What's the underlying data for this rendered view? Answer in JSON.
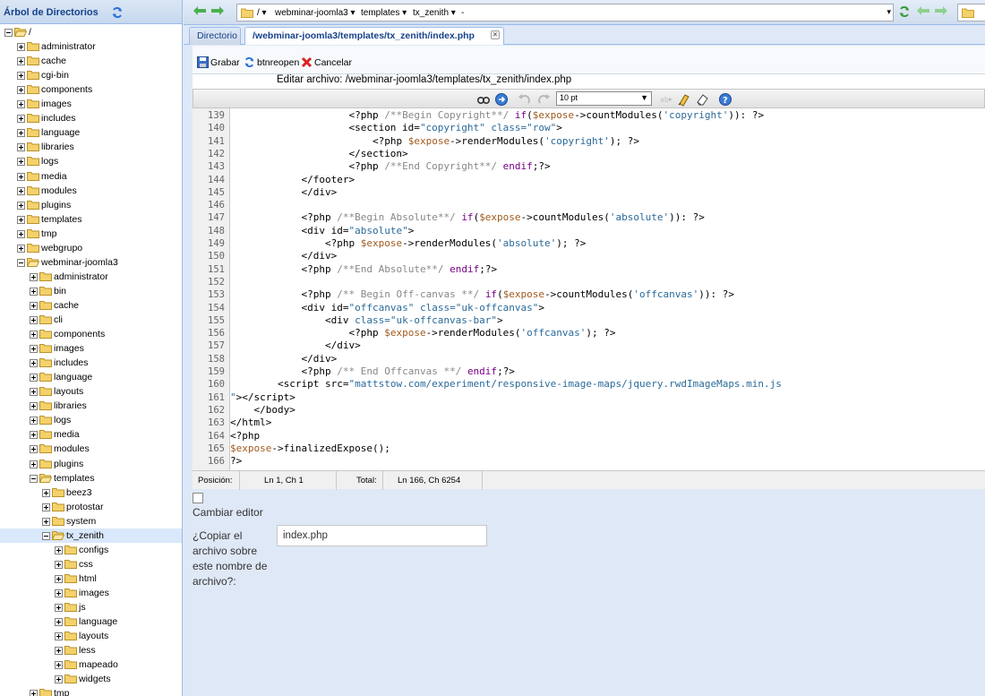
{
  "sidebar": {
    "title": "Árbol de Directorios",
    "tree": [
      {
        "label": "/",
        "depth": 0,
        "open": true
      },
      {
        "label": "administrator",
        "depth": 1
      },
      {
        "label": "cache",
        "depth": 1
      },
      {
        "label": "cgi-bin",
        "depth": 1
      },
      {
        "label": "components",
        "depth": 1
      },
      {
        "label": "images",
        "depth": 1
      },
      {
        "label": "includes",
        "depth": 1
      },
      {
        "label": "language",
        "depth": 1
      },
      {
        "label": "libraries",
        "depth": 1
      },
      {
        "label": "logs",
        "depth": 1
      },
      {
        "label": "media",
        "depth": 1
      },
      {
        "label": "modules",
        "depth": 1
      },
      {
        "label": "plugins",
        "depth": 1
      },
      {
        "label": "templates",
        "depth": 1
      },
      {
        "label": "tmp",
        "depth": 1
      },
      {
        "label": "webgrupo",
        "depth": 1
      },
      {
        "label": "webminar-joomla3",
        "depth": 1,
        "open": true
      },
      {
        "label": "administrator",
        "depth": 2
      },
      {
        "label": "bin",
        "depth": 2
      },
      {
        "label": "cache",
        "depth": 2
      },
      {
        "label": "cli",
        "depth": 2
      },
      {
        "label": "components",
        "depth": 2
      },
      {
        "label": "images",
        "depth": 2
      },
      {
        "label": "includes",
        "depth": 2
      },
      {
        "label": "language",
        "depth": 2
      },
      {
        "label": "layouts",
        "depth": 2
      },
      {
        "label": "libraries",
        "depth": 2
      },
      {
        "label": "logs",
        "depth": 2
      },
      {
        "label": "media",
        "depth": 2
      },
      {
        "label": "modules",
        "depth": 2
      },
      {
        "label": "plugins",
        "depth": 2
      },
      {
        "label": "templates",
        "depth": 2,
        "open": true
      },
      {
        "label": "beez3",
        "depth": 3
      },
      {
        "label": "protostar",
        "depth": 3
      },
      {
        "label": "system",
        "depth": 3
      },
      {
        "label": "tx_zenith",
        "depth": 3,
        "open": true,
        "selected": true
      },
      {
        "label": "configs",
        "depth": 4
      },
      {
        "label": "css",
        "depth": 4
      },
      {
        "label": "html",
        "depth": 4
      },
      {
        "label": "images",
        "depth": 4
      },
      {
        "label": "js",
        "depth": 4
      },
      {
        "label": "language",
        "depth": 4
      },
      {
        "label": "layouts",
        "depth": 4
      },
      {
        "label": "less",
        "depth": 4
      },
      {
        "label": "mapeado",
        "depth": 4
      },
      {
        "label": "widgets",
        "depth": 4
      },
      {
        "label": "tmp",
        "depth": 2
      }
    ]
  },
  "pathbar": {
    "crumbs": [
      "/",
      "webminar-joomla3",
      "templates",
      "tx_zenith",
      "-"
    ]
  },
  "tabs": {
    "directory": "Directorio",
    "file": "/webminar-joomla3/templates/tx_zenith/index.php"
  },
  "actions": {
    "save": "Grabar",
    "reopen": "btnreopen",
    "cancel": "Cancelar"
  },
  "edit_label": "Editar archivo: /webminar-joomla3/templates/tx_zenith/index.php",
  "editor": {
    "font_size": "10 pt",
    "lines": [
      {
        "n": "139",
        "html": "                    <span class=\"t\">&lt;?php</span> <span class=\"c\">/**Begin Copyright**/</span> <span class=\"k\">if</span>(<span class=\"v\">$expose</span>-&gt;countModules(<span class=\"q\">'copyright'</span>)): <span class=\"t\">?&gt;</span>"
      },
      {
        "n": "140",
        "html": "                    <span class=\"t\">&lt;section</span> id=<span class=\"q\">\"copyright\"</span> <span class=\"q\">class=\"row\"</span><span class=\"t\">&gt;</span>"
      },
      {
        "n": "141",
        "html": "                        <span class=\"t\">&lt;?php</span> <span class=\"v\">$expose</span>-&gt;renderModules(<span class=\"q\">'copyright'</span>); <span class=\"t\">?&gt;</span>"
      },
      {
        "n": "142",
        "html": "                    <span class=\"t\">&lt;/section&gt;</span>"
      },
      {
        "n": "143",
        "html": "                    <span class=\"t\">&lt;?php</span> <span class=\"c\">/**End Copyright**/</span> <span class=\"k\">endif</span>;<span class=\"t\">?&gt;</span>"
      },
      {
        "n": "144",
        "html": "            <span class=\"t\">&lt;/footer&gt;</span>"
      },
      {
        "n": "145",
        "html": "            <span class=\"t\">&lt;/div&gt;</span>"
      },
      {
        "n": "146",
        "html": ""
      },
      {
        "n": "147",
        "html": "            <span class=\"t\">&lt;?php</span> <span class=\"c\">/**Begin Absolute**/</span> <span class=\"k\">if</span>(<span class=\"v\">$expose</span>-&gt;countModules(<span class=\"q\">'absolute'</span>)): <span class=\"t\">?&gt;</span>"
      },
      {
        "n": "148",
        "html": "            <span class=\"t\">&lt;div</span> id=<span class=\"q\">\"absolute\"</span><span class=\"t\">&gt;</span>"
      },
      {
        "n": "149",
        "html": "                <span class=\"t\">&lt;?php</span> <span class=\"v\">$expose</span>-&gt;renderModules(<span class=\"q\">'absolute'</span>); <span class=\"t\">?&gt;</span>"
      },
      {
        "n": "150",
        "html": "            <span class=\"t\">&lt;/div&gt;</span>"
      },
      {
        "n": "151",
        "html": "            <span class=\"t\">&lt;?php</span> <span class=\"c\">/**End Absolute**/</span> <span class=\"k\">endif</span>;<span class=\"t\">?&gt;</span>"
      },
      {
        "n": "152",
        "html": ""
      },
      {
        "n": "153",
        "html": "            <span class=\"t\">&lt;?php</span> <span class=\"c\">/** Begin Off-canvas **/</span> <span class=\"k\">if</span>(<span class=\"v\">$expose</span>-&gt;countModules(<span class=\"q\">'offcanvas'</span>)): <span class=\"t\">?&gt;</span>"
      },
      {
        "n": "154",
        "html": "            <span class=\"t\">&lt;div</span> id=<span class=\"q\">\"offcanvas\"</span> <span class=\"q\">class=\"uk-offcanvas\"</span><span class=\"t\">&gt;</span>"
      },
      {
        "n": "155",
        "html": "                <span class=\"t\">&lt;div</span> <span class=\"q\">class=\"uk-offcanvas-bar\"</span><span class=\"t\">&gt;</span>"
      },
      {
        "n": "156",
        "html": "                    <span class=\"t\">&lt;?php</span> <span class=\"v\">$expose</span>-&gt;renderModules(<span class=\"q\">'offcanvas'</span>); <span class=\"t\">?&gt;</span>"
      },
      {
        "n": "157",
        "html": "                <span class=\"t\">&lt;/div&gt;</span>"
      },
      {
        "n": "158",
        "html": "            <span class=\"t\">&lt;/div&gt;</span>"
      },
      {
        "n": "159",
        "html": "            <span class=\"t\">&lt;?php</span> <span class=\"c\">/** End Offcanvas **/</span> <span class=\"k\">endif</span>;<span class=\"t\">?&gt;</span>"
      },
      {
        "n": "160",
        "html": "        <span class=\"t\">&lt;script</span> src=<span class=\"q\">\"mattstow.com/experiment/responsive-image-maps/jquery.rwdImageMaps.min.js</span>"
      },
      {
        "n": "161",
        "html": "<span class=\"q\">\"</span><span class=\"t\">&gt;&lt;/script&gt;</span>"
      },
      {
        "n": "162",
        "html": "    <span class=\"t\">&lt;/body&gt;</span>"
      },
      {
        "n": "163",
        "html": "<span class=\"t\">&lt;/html&gt;</span>"
      },
      {
        "n": "164",
        "html": "<span class=\"t\">&lt;?php</span>"
      },
      {
        "n": "165",
        "html": "<span class=\"v\">$expose</span>-&gt;finalizedExpose();"
      },
      {
        "n": "166",
        "html": "<span class=\"t\">?&gt;</span>"
      }
    ]
  },
  "status": {
    "position_label": "Posición:",
    "position_value": "Ln 1, Ch 1",
    "total_label": "Total:",
    "total_value": "Ln 166, Ch 6254"
  },
  "options": {
    "change_editor": "Cambiar editor",
    "copy_label": "¿Copiar el archivo sobre este nombre de archivo?:",
    "copy_value": "index.php"
  }
}
